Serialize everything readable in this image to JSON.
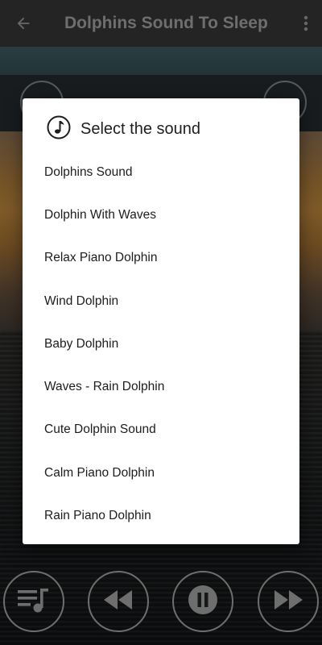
{
  "app": {
    "title": "Dolphins Sound To Sleep"
  },
  "dialog": {
    "title": "Select the sound",
    "items": [
      "Dolphins Sound",
      "Dolphin With Waves",
      "Relax Piano Dolphin",
      "Wind Dolphin",
      "Baby Dolphin",
      "Waves - Rain Dolphin",
      "Cute Dolphin Sound",
      "Calm Piano Dolphin",
      "Rain Piano Dolphin"
    ]
  },
  "icons": {
    "back": "back-arrow-icon",
    "more": "more-vert-icon",
    "dialog": "music-note-icon",
    "playlist": "playlist-music-icon",
    "rewind": "rewind-icon",
    "pause": "pause-icon",
    "forward": "fast-forward-icon"
  },
  "colors": {
    "appbar": "#424242",
    "dialog_bg": "#ffffff",
    "control_stroke": "#c8c8c8"
  }
}
